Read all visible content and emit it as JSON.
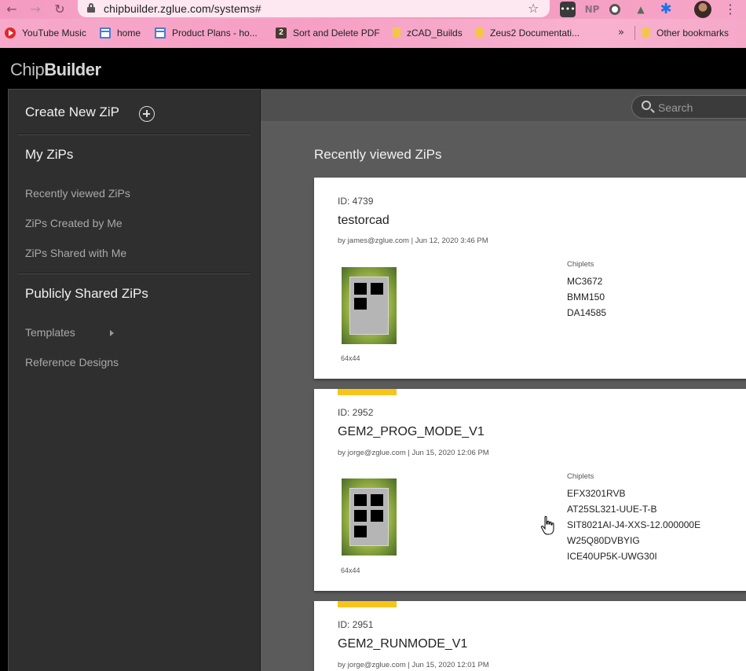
{
  "browser": {
    "url": "chipbuilder.zglue.com/systems#",
    "bookmarks": [
      "YouTube Music",
      "home",
      "Product Plans - ho...",
      "Sort and Delete PDF",
      "zCAD_Builds",
      "Zeus2 Documentati..."
    ],
    "overflow": "»",
    "other_bookmarks": "Other bookmarks",
    "extension_np": "NP"
  },
  "app": {
    "logo_light": "Chip",
    "logo_bold": "Builder"
  },
  "sidebar": {
    "create_label": "Create New ZiP",
    "my_zips_title": "My ZiPs",
    "my_zips_items": [
      "Recently viewed ZiPs",
      "ZiPs Created by Me",
      "ZiPs Shared with Me"
    ],
    "public_title": "Publicly Shared ZiPs",
    "public_items": [
      "Templates",
      "Reference Designs"
    ]
  },
  "main": {
    "search_placeholder": "Search",
    "heading": "Recently viewed ZiPs",
    "chiplets_label": "Chiplets",
    "cards": [
      {
        "id": "ID: 4739",
        "name": "testorcad",
        "meta": "by james@zglue.com | Jun 12, 2020 3:46 PM",
        "size": "64x44",
        "chiplets": [
          "MC3672",
          "BMM150",
          "DA14585"
        ]
      },
      {
        "id": "ID: 2952",
        "name": "GEM2_PROG_MODE_V1",
        "meta": "by jorge@zglue.com | Jun 15, 2020 12:06 PM",
        "size": "64x44",
        "chiplets": [
          "EFX3201RVB",
          "AT25SL321-UUE-T-B",
          "SIT8021AI-J4-XXS-12.000000E",
          "W25Q80DVBYIG",
          "ICE40UP5K-UWG30I"
        ]
      },
      {
        "id": "ID: 2951",
        "name": "GEM2_RUNMODE_V1",
        "meta": "by jorge@zglue.com | Jun 15, 2020 12:01 PM"
      }
    ]
  },
  "colors": {
    "accent_bar": "#f7c51a",
    "sidebar_bg": "#2f2f2f",
    "main_bg": "#5b5b5b"
  }
}
